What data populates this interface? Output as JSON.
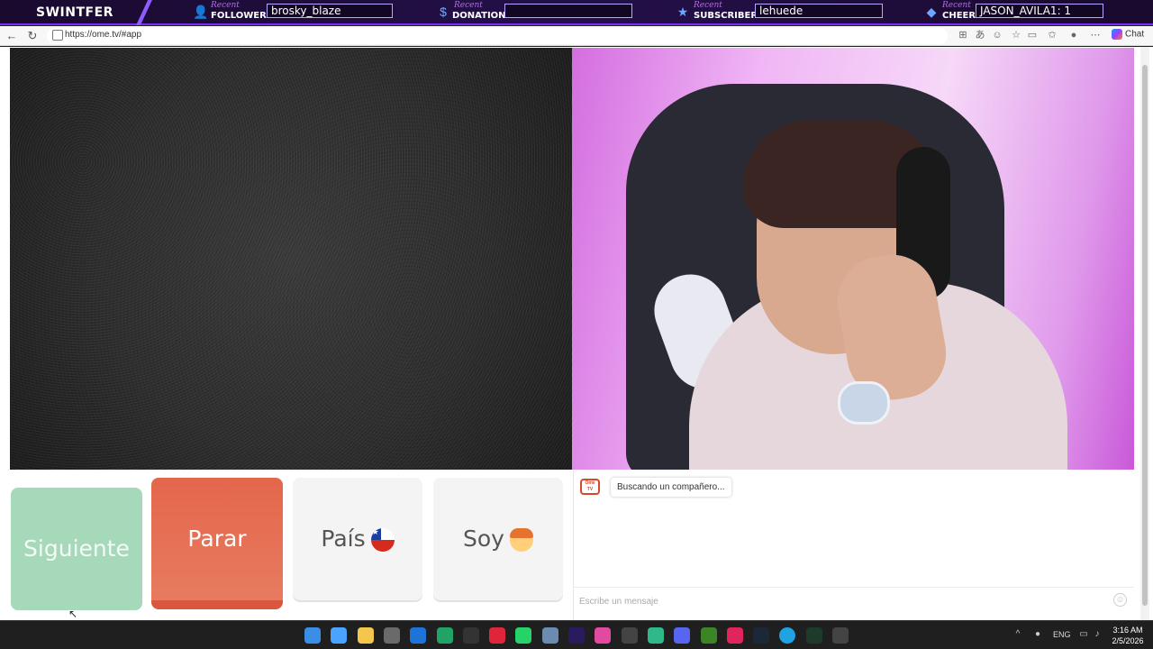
{
  "overlay": {
    "brand": "SWINTFER",
    "follower": {
      "recent": "Recent",
      "label": "FOLLOWER",
      "value": "brosky_blaze"
    },
    "donation": {
      "recent": "Recent",
      "label": "DONATION",
      "value": ""
    },
    "subscriber": {
      "recent": "Recent",
      "label": "SUBSCRIBER",
      "value": "lehuede"
    },
    "cheer": {
      "recent": "Recent",
      "label": "CHEER",
      "value": "JASON_AVILA1: 1"
    }
  },
  "browser": {
    "url": "https://ome.tv/#app",
    "chat_label": "Chat"
  },
  "buttons": {
    "next": "Siguiente",
    "stop": "Parar",
    "country": "País",
    "gender": "Soy"
  },
  "chat": {
    "logo_text": "Ome TV",
    "status": "Buscando un compañero...",
    "input_placeholder": "Escribe un mensaje"
  },
  "taskbar": {
    "lang": "ENG",
    "time": "3:16 AM",
    "date": "2/5/2026",
    "icons": [
      "windows-start-icon",
      "cortana-icon",
      "file-explorer-icon",
      "store-icon",
      "outlook-icon",
      "sheets-icon",
      "app-c-icon",
      "app-red-icon",
      "whatsapp-icon",
      "app-globe-icon",
      "premiere-icon",
      "app-gradient-icon",
      "app-grid-icon",
      "app-green-icon",
      "discord-icon",
      "minecraft-icon",
      "kick-icon",
      "steam-icon",
      "edge-icon",
      "app-dark-icon",
      "app-g-icon"
    ],
    "icon_colors": [
      "#3a8ee6",
      "#4aa3ff",
      "#f4c64b",
      "#6a6a6a",
      "#1e73d8",
      "#21a366",
      "#333333",
      "#e0243a",
      "#25d366",
      "#6b8bb0",
      "#2a1a5e",
      "#e24aa0",
      "#444444",
      "#2fb889",
      "#5865f2",
      "#3b8526",
      "#e0245e",
      "#1b2838",
      "#1fa3e2",
      "#1e3a2a",
      "#444444"
    ]
  },
  "colors": {
    "next_button": "#a6d9b9",
    "stop_button": "#e4664c",
    "overlay_accent": "#7b2cff"
  }
}
